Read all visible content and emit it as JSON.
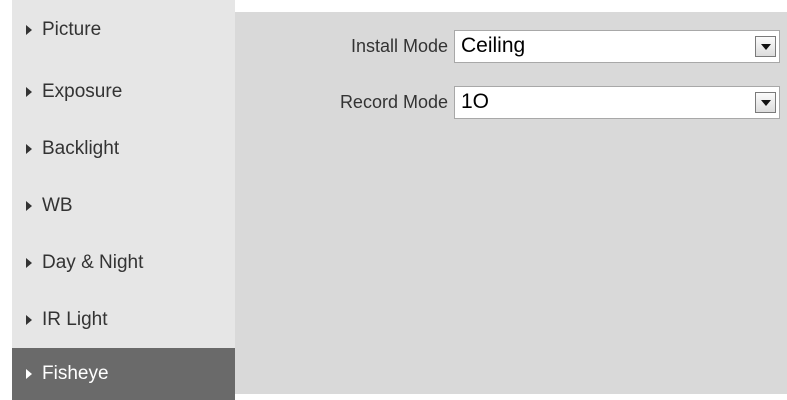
{
  "sidebar": {
    "items": [
      {
        "label": "Picture"
      },
      {
        "label": "Exposure"
      },
      {
        "label": "Backlight"
      },
      {
        "label": "WB"
      },
      {
        "label": "Day & Night"
      },
      {
        "label": "IR Light"
      },
      {
        "label": "Fisheye",
        "active": true
      }
    ]
  },
  "form": {
    "install_mode": {
      "label": "Install Mode",
      "value": "Ceiling"
    },
    "record_mode": {
      "label": "Record Mode",
      "value": "1O"
    }
  },
  "colors": {
    "sidebar_bg": "#e6e6e6",
    "active_bg": "#6a6a6a",
    "panel_bg": "#d9d9d9"
  },
  "icons": {
    "sidebar_arrow": "caret-right-icon",
    "dropdown": "chevron-down-icon"
  }
}
